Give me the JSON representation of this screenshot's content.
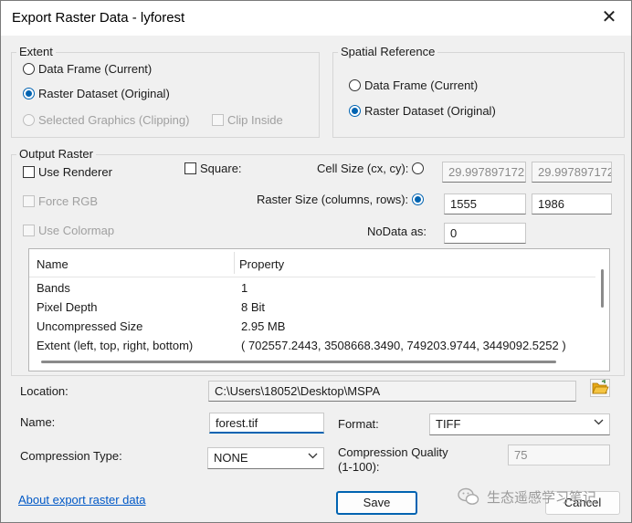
{
  "window": {
    "title": "Export Raster Data - lyforest",
    "close_glyph": "✕"
  },
  "extent": {
    "legend": "Extent",
    "data_frame": "Data Frame (Current)",
    "raster_dataset": "Raster Dataset (Original)",
    "selected_graphics": "Selected Graphics (Clipping)",
    "clip_inside": "Clip Inside",
    "selected": "raster_dataset"
  },
  "spatial_reference": {
    "legend": "Spatial Reference",
    "data_frame": "Data Frame (Current)",
    "raster_dataset": "Raster Dataset (Original)",
    "selected": "raster_dataset"
  },
  "output_raster": {
    "legend": "Output Raster",
    "use_renderer": "Use Renderer",
    "force_rgb": "Force RGB",
    "use_colormap": "Use Colormap",
    "square": "Square:",
    "cell_size_label": "Cell Size (cx, cy):",
    "cell_size_cx": "29.997897172",
    "cell_size_cy": "29.997897172",
    "raster_size_label": "Raster Size (columns, rows):",
    "columns": "1555",
    "rows": "1986",
    "nodata_label": "NoData as:",
    "nodata_value": "0",
    "selected_size_mode": "raster_size"
  },
  "properties": {
    "col_name": "Name",
    "col_property": "Property",
    "rows": [
      {
        "name": "Bands",
        "value": "1"
      },
      {
        "name": "Pixel Depth",
        "value": "8 Bit"
      },
      {
        "name": "Uncompressed Size",
        "value": "2.95 MB"
      },
      {
        "name": "Extent (left, top, right, bottom)",
        "value": "( 702557.2443, 3508668.3490, 749203.9744, 3449092.5252 )"
      }
    ]
  },
  "location": {
    "label": "Location:",
    "value": "C:\\Users\\18052\\Desktop\\MSPA"
  },
  "name_field": {
    "label": "Name:",
    "value": "forest.tif"
  },
  "format": {
    "label": "Format:",
    "value": "TIFF"
  },
  "compression_type": {
    "label": "Compression Type:",
    "value": "NONE"
  },
  "compression_quality": {
    "label_line1": "Compression Quality",
    "label_line2": "(1-100):",
    "value": "75"
  },
  "footer": {
    "help_link": "About export raster data",
    "save": "Save",
    "cancel": "Cancel"
  },
  "watermark": {
    "text": "生态遥感学习笔记"
  },
  "icons": {
    "folder": "folder-open-icon",
    "chevron": "chevron-down-icon"
  },
  "colors": {
    "accent": "#0063b1",
    "link": "#0058c6",
    "folder": "#e6a817"
  }
}
